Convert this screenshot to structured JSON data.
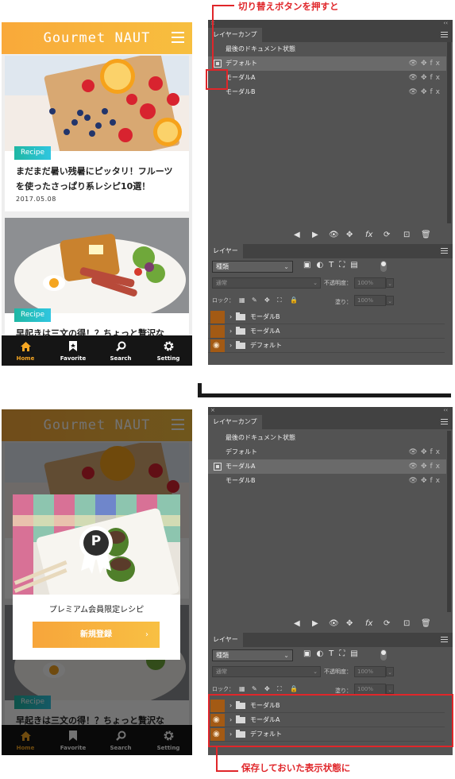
{
  "phone": {
    "title": "Gourmet NAUT",
    "cards": [
      {
        "tag": "Recipe",
        "title": "まだまだ暑い残暑にピッタリ！フルーツを使ったさっぱり系レシピ10選！",
        "date": "2017.05.08"
      },
      {
        "tag": "Recipe",
        "title": "早起きは三文の得！？ちょっと贅沢な"
      }
    ],
    "tabs": [
      {
        "label": "Home",
        "icon": "home-icon"
      },
      {
        "label": "Favorite",
        "icon": "bookmark-icon"
      },
      {
        "label": "Search",
        "icon": "search-icon"
      },
      {
        "label": "Setting",
        "icon": "gear-icon"
      }
    ],
    "active_tab": "Home",
    "modal": {
      "badge": "P",
      "caption": "プレミアム会員限定レシピ",
      "button": "新規登録",
      "button_arrow": "›"
    }
  },
  "ps": {
    "close": "×",
    "collapse": "‹‹",
    "comps_tab": "レイヤーカンプ",
    "last_state": "最後のドキュメント状態",
    "tails": "👁✥fx",
    "layers_tab": "レイヤー",
    "search_kind": "種類",
    "filter_icons": "▣◐T⛶▤",
    "blend_mode": "通常",
    "opacity_label": "不透明度：",
    "opacity_value": "100%",
    "lock_label": "ロック：",
    "fill_label": "塗り：",
    "fill_value": "100%",
    "layer_names": [
      "モーダルB",
      "モーダルA",
      "デフォルト"
    ],
    "top": {
      "comps": [
        "デフォルト",
        "モーダルA",
        "モーダルB"
      ],
      "selected_comp": "デフォルト",
      "visible_layers": [
        false,
        false,
        true
      ]
    },
    "bottom": {
      "comps": [
        "デフォルト",
        "モーダルA",
        "モーダルB"
      ],
      "selected_comp": "モーダルA",
      "visible_layers": [
        false,
        true,
        true
      ]
    }
  },
  "annotations": {
    "top": "切り替えボタンを押すと",
    "bottom": "保存しておいた表示状態に"
  },
  "colors": {
    "accent": "#f7a93b",
    "annotation": "#e0262a",
    "panel": "#535353"
  }
}
